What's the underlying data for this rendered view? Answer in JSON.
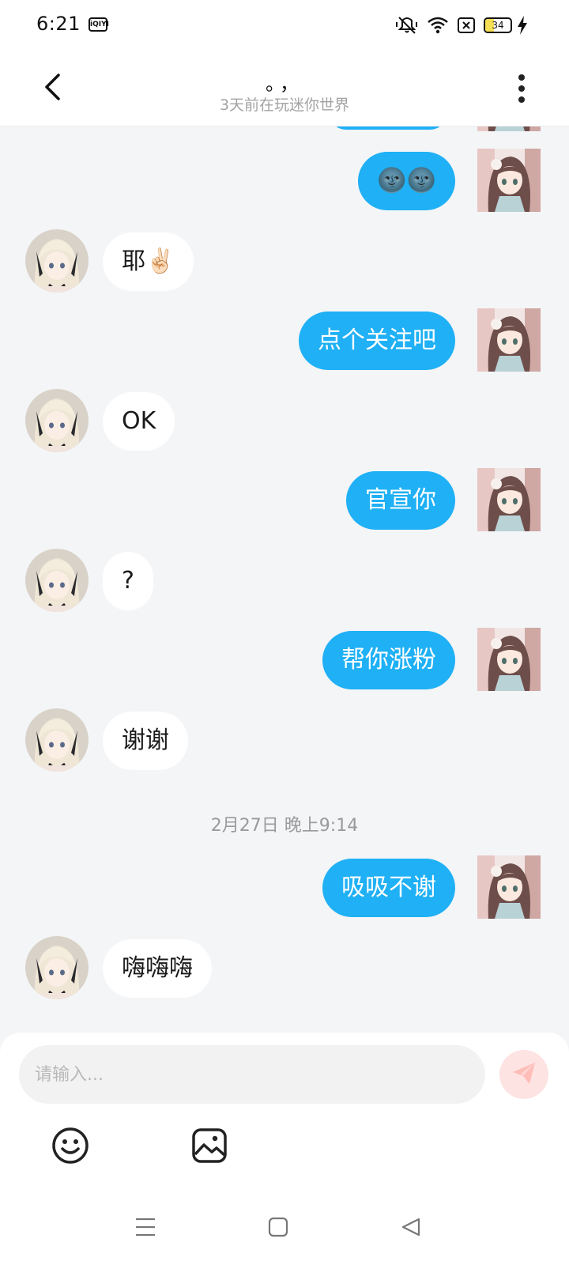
{
  "status_bar": {
    "time": "6:21",
    "app_badge": "iQIYI",
    "battery_level": "34",
    "battery_fraction": 0.34,
    "icons": [
      "mute-icon",
      "wifi-icon",
      "no-sim-icon",
      "battery-icon",
      "charging-icon"
    ]
  },
  "header": {
    "title": "。，",
    "subtitle": "3天前在玩迷你世界",
    "back_icon": "chevron-left-icon",
    "more_icon": "more-vertical-icon"
  },
  "colors": {
    "outgoing_bubble": "#1fb0f5",
    "incoming_bubble": "#ffffff",
    "background": "#f4f5f7",
    "send_button": "#fde3e2",
    "send_icon": "#ffbdb8"
  },
  "messages": [
    {
      "side": "out",
      "text": "🌚🌚"
    },
    {
      "side": "in",
      "text": "耶✌🏻"
    },
    {
      "side": "out",
      "text": "点个关注吧"
    },
    {
      "side": "in",
      "text": "OK"
    },
    {
      "side": "out",
      "text": "官宣你"
    },
    {
      "side": "in",
      "text": "?"
    },
    {
      "side": "out",
      "text": "帮你涨粉"
    },
    {
      "side": "in",
      "text": "谢谢"
    },
    {
      "side": "out",
      "text": "吸吸不谢"
    },
    {
      "side": "in",
      "text": "嗨嗨嗨"
    }
  ],
  "time_divider": "2月27日 晚上9:14",
  "composer": {
    "placeholder": "请输入...",
    "value": "",
    "send_icon": "send-plane-icon",
    "tools": [
      "emoji-icon",
      "image-icon"
    ]
  },
  "nav_bar": {
    "buttons": [
      "menu-icon",
      "home-icon",
      "back-triangle-icon"
    ]
  }
}
